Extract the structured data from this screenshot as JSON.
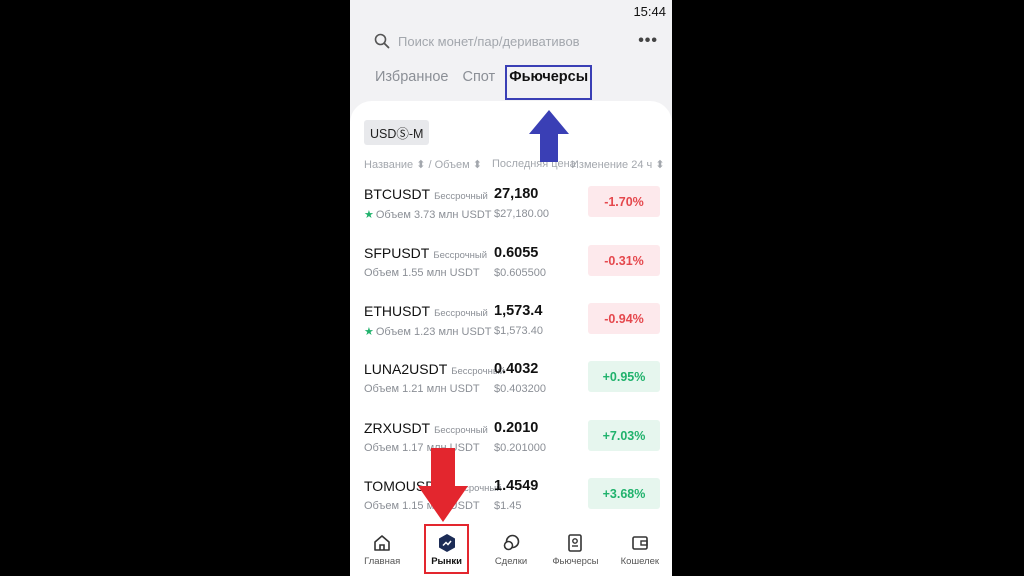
{
  "status": {
    "time": "15:44"
  },
  "search": {
    "placeholder": "Поиск монет/пар/деривативов"
  },
  "tabs": [
    {
      "label": "Избранное"
    },
    {
      "label": "Спот"
    },
    {
      "label": "Фьючерсы"
    }
  ],
  "filter": {
    "label": "USDⓈ-M"
  },
  "columns": {
    "name": "Название",
    "volume": "/ Объем",
    "last_price": "Последняя цена",
    "change": "Изменение 24 ч"
  },
  "rows": [
    {
      "pair": "BTCUSDT",
      "type": "Бессрочный",
      "starred": true,
      "volume": "Объем 3.73 млн USDT",
      "price": "27,180",
      "subprice": "$27,180.00",
      "change": "-1.70%"
    },
    {
      "pair": "SFPUSDT",
      "type": "Бессрочный",
      "starred": false,
      "volume": "Объем 1.55 млн USDT",
      "price": "0.6055",
      "subprice": "$0.605500",
      "change": "-0.31%"
    },
    {
      "pair": "ETHUSDT",
      "type": "Бессрочный",
      "starred": true,
      "volume": "Объем 1.23 млн USDT",
      "price": "1,573.4",
      "subprice": "$1,573.40",
      "change": "-0.94%"
    },
    {
      "pair": "LUNA2USDT",
      "type": "Бессрочный",
      "starred": false,
      "volume": "Объем 1.21 млн USDT",
      "price": "0.4032",
      "subprice": "$0.403200",
      "change": "+0.95%"
    },
    {
      "pair": "ZRXUSDT",
      "type": "Бессрочный",
      "starred": false,
      "volume": "Объем 1.17 млн USDT",
      "price": "0.2010",
      "subprice": "$0.201000",
      "change": "+7.03%"
    },
    {
      "pair": "TOMOUSDT",
      "type": "Бессрочный",
      "starred": false,
      "volume": "Объем 1.15 млн USDT",
      "price": "1.4549",
      "subprice": "$1.45",
      "change": "+3.68%"
    }
  ],
  "nav": [
    {
      "label": "Главная",
      "icon": "home-icon"
    },
    {
      "label": "Рынки",
      "icon": "markets-icon"
    },
    {
      "label": "Сделки",
      "icon": "trades-icon"
    },
    {
      "label": "Фьючерсы",
      "icon": "futures-icon"
    },
    {
      "label": "Кошелек",
      "icon": "wallet-icon"
    }
  ],
  "colors": {
    "negative": "#e5484d",
    "positive": "#20b26c",
    "annotation_blue": "#3a3fb5",
    "annotation_red": "#e3262e"
  }
}
